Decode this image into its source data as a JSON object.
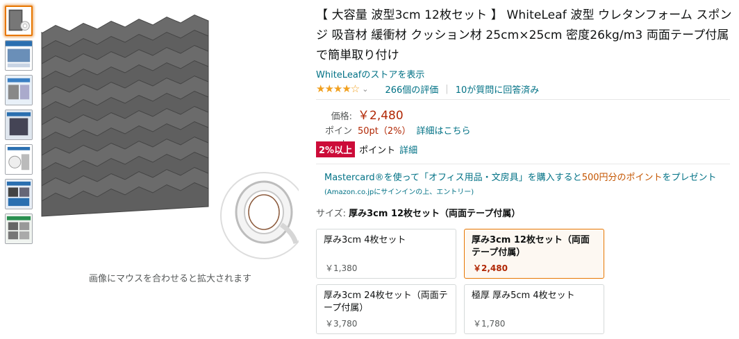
{
  "thumbnails": [
    {
      "name": "thumb-main",
      "selected": true
    },
    {
      "name": "thumb-2",
      "selected": false
    },
    {
      "name": "thumb-3",
      "selected": false
    },
    {
      "name": "thumb-4",
      "selected": false
    },
    {
      "name": "thumb-5",
      "selected": false
    },
    {
      "name": "thumb-6",
      "selected": false
    },
    {
      "name": "thumb-7",
      "selected": false
    }
  ],
  "image_hint": "画像にマウスを合わせると拡大されます",
  "product": {
    "title": "【 大容量 波型3cm 12枚セット 】 WhiteLeaf 波型 ウレタンフォーム スポンジ 吸音材 緩衝材 クッション材 25cm×25cm 密度26kg/m3 両面テープ付属で簡単取り付け",
    "store_link": "WhiteLeafのストアを表示",
    "rating": {
      "stars": "★★★★",
      "half": "☆",
      "chevron": "⌄",
      "reviews": "266個の評価",
      "sep": "|",
      "answers": "10が質問に回答済み"
    },
    "price_label": "価格:",
    "price": "￥2,480",
    "points_label": "ポイント:",
    "points_value": "50pt（2%）",
    "points_link": "詳細はこちら",
    "promo_badge": "2%以上",
    "promo_text": "ポイント",
    "promo_link": "詳細",
    "mastercard": {
      "part1": "Mastercard®を使って「オフィス用品・文房具」を購入すると",
      "highlight": "500円分のポイント",
      "part2": "をプレゼント",
      "note": "(Amazon.co.jpにサインインの上、エントリー)"
    },
    "size_label": "サイズ:",
    "size_selected": "厚み3cm 12枚セット（両面テープ付属）"
  },
  "options": [
    {
      "name": "厚み3cm 4枚セット",
      "price": "￥1,380",
      "selected": false
    },
    {
      "name": "厚み3cm 12枚セット（両面テープ付属）",
      "price": "￥2,480",
      "selected": true
    },
    {
      "name": "厚み3cm 24枚セット（両面テープ付属）",
      "price": "￥3,780",
      "selected": false
    },
    {
      "name": "極厚 厚み5cm 4枚セット",
      "price": "￥1,780",
      "selected": false
    }
  ],
  "colors": {
    "accent_orange": "#e77600",
    "price_red": "#b12704",
    "link_teal": "#007185",
    "badge_red": "#cc0c39",
    "star": "#f1a01f"
  }
}
